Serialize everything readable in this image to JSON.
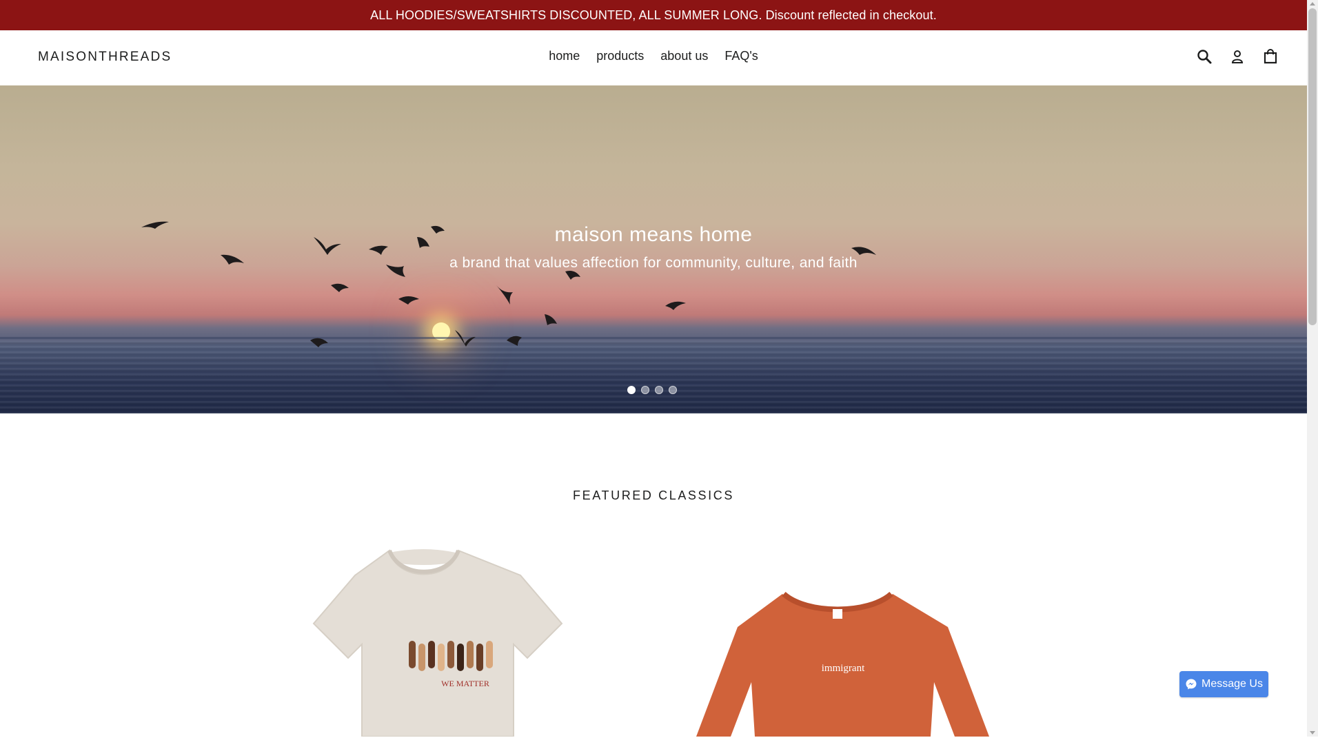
{
  "announcement": {
    "text": "ALL HOODIES/SWEATSHIRTS DISCOUNTED, ALL SUMMER LONG. Discount reflected in checkout."
  },
  "header": {
    "logo": "MAISONTHREADS",
    "nav": [
      {
        "label": "home"
      },
      {
        "label": "products"
      },
      {
        "label": "about us"
      },
      {
        "label": "FAQ's"
      }
    ],
    "icons": [
      "search-icon",
      "account-icon",
      "cart-icon"
    ]
  },
  "hero": {
    "title": "maison means home",
    "subtitle": "a brand that values affection for community, culture, and faith",
    "slides": 4,
    "active_slide": 1
  },
  "featured": {
    "title": "FEATURED CLASSICS",
    "products": [
      {
        "print_text": "WE MATTER",
        "color": "#e4ded6"
      },
      {
        "print_text": "immigrant",
        "color": "#d0623a"
      }
    ]
  },
  "chat": {
    "label": "Message Us",
    "color": "#4a86e8"
  },
  "colors": {
    "announcement_bg": "#8c1414",
    "accent": "#4a86e8"
  }
}
